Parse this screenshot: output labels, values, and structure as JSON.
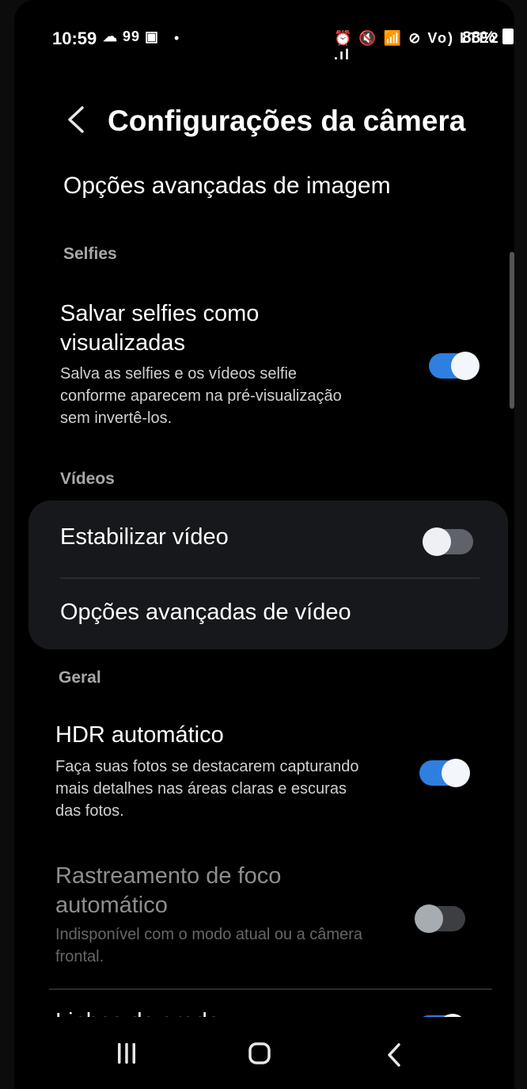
{
  "status_bar": {
    "time": "10:59",
    "left_icons": "☁ 99 ▣",
    "dot": "•",
    "right_icons": "⏰ 🔇 📶 ⊘ Vo) LTE2 .ıl",
    "battery": "88%"
  },
  "header": {
    "title": "Configurações da câmera",
    "back_icon": "back-chevron-icon"
  },
  "advanced_image_link": "Opções avançadas de imagem",
  "sections": {
    "selfies": "Selfies",
    "videos": "Vídeos",
    "general": "Geral"
  },
  "items": {
    "save_selfies": {
      "title": "Salvar selfies como visualizadas",
      "desc": "Salva as selfies e os vídeos selfie conforme aparecem na pré-visualização sem invertê-los.",
      "state": "on"
    },
    "stabilize_video": {
      "title": "Estabilizar vídeo",
      "state": "off"
    },
    "advanced_video": {
      "title": "Opções avançadas de vídeo"
    },
    "auto_hdr": {
      "title": "HDR automático",
      "desc": "Faça suas fotos se destacarem capturando mais detalhes nas áreas claras e escuras das fotos.",
      "state": "on"
    },
    "tracking_af": {
      "title": "Rastreamento de foco automático",
      "desc": "Indisponível com o modo atual ou a câmera frontal.",
      "state": "disabled-off"
    },
    "grid_lines": {
      "title": "Linhas de grade",
      "state": "on"
    }
  },
  "nav_bar": {
    "recents": "recents-icon",
    "home": "home-icon",
    "back": "back-icon"
  },
  "colors": {
    "toggle_on": "#2f7fe0",
    "background": "#000000"
  }
}
